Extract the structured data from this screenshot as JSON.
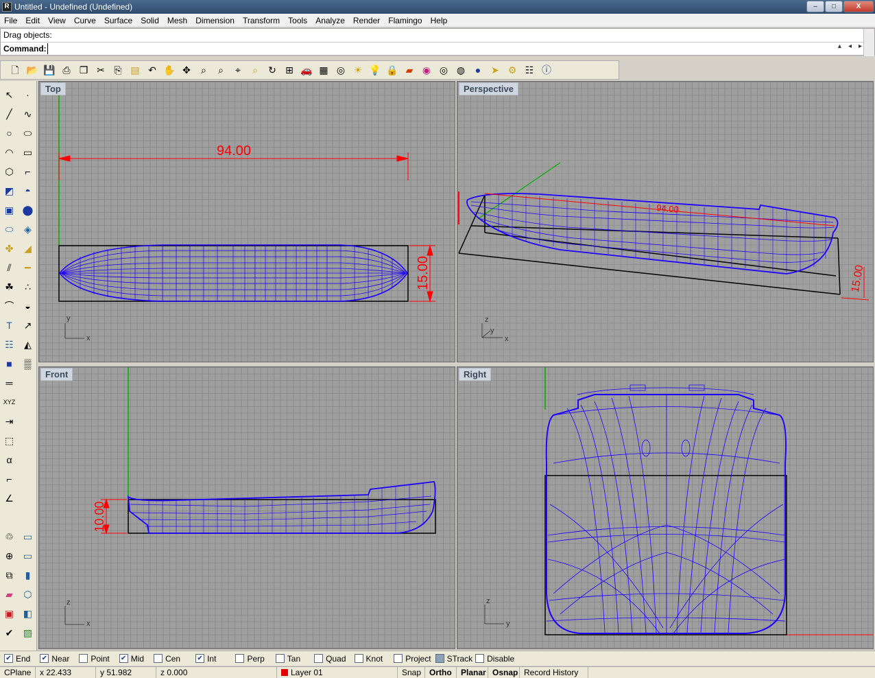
{
  "window": {
    "title": "Untitled - Undefined (Undefined)",
    "buttons": [
      "–",
      "□",
      "X"
    ]
  },
  "menu": [
    "File",
    "Edit",
    "View",
    "Curve",
    "Surface",
    "Solid",
    "Mesh",
    "Dimension",
    "Transform",
    "Tools",
    "Analyze",
    "Render",
    "Flamingo",
    "Help"
  ],
  "command": {
    "history": "Drag objects:",
    "label": "Command:",
    "value": ""
  },
  "toolbar_icons": [
    "new-icon",
    "open-icon",
    "save-icon",
    "print-icon",
    "export-icon",
    "cut-icon",
    "copy-icon",
    "paste-icon",
    "undo-icon",
    "pan-icon",
    "rotate-view-icon",
    "zoom-icon",
    "zoom-window-icon",
    "zoom-extents-icon",
    "zoom-selected-icon",
    "rotate-icon",
    "four-view-icon",
    "car-icon",
    "grid-icon",
    "target-icon",
    "sun-icon",
    "light-bulb-icon",
    "lock-icon",
    "layer-icon",
    "color-wheel-icon",
    "sphere-wire-icon",
    "sphere-mesh-icon",
    "sphere-render-icon",
    "cursor-icon",
    "settings-icon",
    "options-icon",
    "help-icon"
  ],
  "viewports": {
    "top": {
      "label": "Top",
      "dim_h": "94.00",
      "dim_v": "15.00",
      "axis_x": "x",
      "axis_y": "y"
    },
    "perspective": {
      "label": "Perspective",
      "dim_h": "94.00",
      "dim_v": "15.00",
      "axis_x": "x",
      "axis_y": "y",
      "axis_z": "z"
    },
    "front": {
      "label": "Front",
      "dim_v": "10.00",
      "axis_x": "x",
      "axis_z": "z"
    },
    "right": {
      "label": "Right",
      "axis_y": "y",
      "axis_z": "z"
    }
  },
  "osnaps": [
    {
      "label": "End",
      "checked": true
    },
    {
      "label": "Near",
      "checked": true
    },
    {
      "label": "Point",
      "checked": false
    },
    {
      "label": "Mid",
      "checked": true
    },
    {
      "label": "Cen",
      "checked": false
    },
    {
      "label": "Int",
      "checked": true
    },
    {
      "label": "Perp",
      "checked": false
    },
    {
      "label": "Tan",
      "checked": false
    },
    {
      "label": "Quad",
      "checked": false
    },
    {
      "label": "Knot",
      "checked": false
    },
    {
      "label": "Project",
      "checked": false
    },
    {
      "label": "STrack",
      "checked": false
    },
    {
      "label": "Disable",
      "checked": false
    }
  ],
  "status": {
    "cplane": "CPlane",
    "x": "x 22.433",
    "y": "y 51.982",
    "z": "z 0.000",
    "layer": "Layer 01",
    "snap": "Snap",
    "ortho": "Ortho",
    "planar": "Planar",
    "osnap": "Osnap",
    "record": "Record History"
  },
  "colors": {
    "hull": "#1e00ff",
    "dimension": "#ff0000",
    "bbox": "#000000",
    "axis_green": "#00aa00"
  }
}
